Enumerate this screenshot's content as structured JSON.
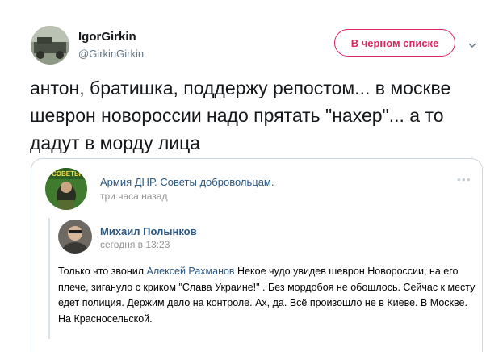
{
  "tweet": {
    "display_name": "IgorGirkin",
    "handle": "@GirkinGirkin",
    "blocked_button_label": "В черном списке",
    "text": "антон, братишка, поддержу репостом... в москве шеврон новороссии надо прятать \"нахер\"... а то дадут в морду лица"
  },
  "embed": {
    "group_avatar_text": "СОВЕТЫ",
    "group_name": "Армия ДНР. Советы добровольцам.",
    "group_time": "три часа назад",
    "more": "•••",
    "repost": {
      "user_name": "Михаил Полынков",
      "time": "сегодня в 13:23",
      "body_prefix": "Только что звонил",
      "body_link": "Алексей Рахманов",
      "body_suffix": "Некое чудо увидев шеврон Новороссии, на его плече, зигануло с криком \"Слава Украине!\" . Без мордобоя не обошлось. Сейчас к месту едет полиция. Держим дело на контроле. Ах, да. Всё произошло не в Киеве. В Москве. На Красносельской."
    }
  },
  "colors": {
    "blocked": "#e0245e",
    "vk_link": "#2a5885",
    "muted": "#657786"
  },
  "icons": {
    "chevron": "chevron-down-icon",
    "more": "more-dots-icon"
  }
}
